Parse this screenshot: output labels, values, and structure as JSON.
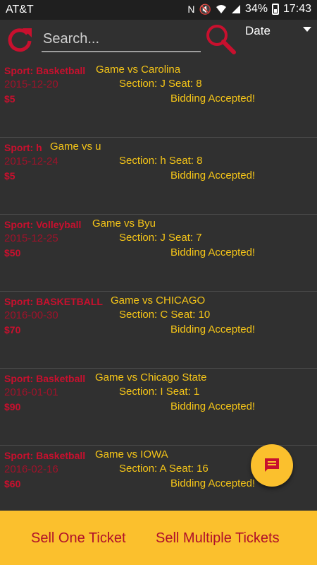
{
  "status_bar": {
    "carrier": "AT&T",
    "battery": "34%",
    "time": "17:43"
  },
  "toolbar": {
    "search_placeholder": "Search...",
    "sort_value": "Date"
  },
  "tickets": [
    {
      "sport": "Sport: Basketball",
      "game": "Game vs Carolina",
      "date": "2015-12-20",
      "seat": "Section: J Seat: 8",
      "price": "$5",
      "status": "Bidding Accepted!"
    },
    {
      "sport": "Sport: h",
      "game": "Game vs u",
      "date": "2015-12-24",
      "seat": "Section: h Seat: 8",
      "price": "$5",
      "status": "Bidding Accepted!"
    },
    {
      "sport": "Sport: Volleyball",
      "game": "Game vs Byu",
      "date": "2015-12-25",
      "seat": "Section: J Seat: 7",
      "price": "$50",
      "status": "Bidding Accepted!"
    },
    {
      "sport": "Sport: BASKETBALL",
      "game": "Game vs CHICAGO",
      "date": "2016-00-30",
      "seat": "Section: C Seat: 10",
      "price": "$70",
      "status": "Bidding Accepted!"
    },
    {
      "sport": "Sport: Basketball",
      "game": "Game vs Chicago State",
      "date": "2016-01-01",
      "seat": "Section: I Seat: 1",
      "price": "$90",
      "status": "Bidding Accepted!"
    },
    {
      "sport": "Sport: Basketball",
      "game": "Game vs IOWA",
      "date": "2016-02-16",
      "seat": "Section: A Seat: 16",
      "price": "$60",
      "status": "Bidding Accepted!"
    }
  ],
  "bottom_bar": {
    "sell_one": "Sell One Ticket",
    "sell_multiple": "Sell Multiple Tickets"
  },
  "colors": {
    "accent_red": "#c8102e",
    "accent_yellow": "#f5c518",
    "background": "#303030",
    "bottom_bar": "#fbc02d"
  }
}
